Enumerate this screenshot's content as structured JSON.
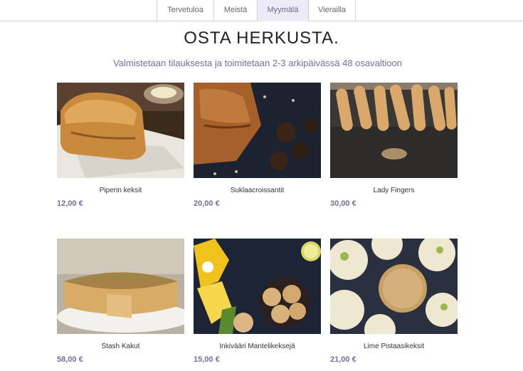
{
  "nav": {
    "tabs": [
      {
        "label": "Tervetuloa"
      },
      {
        "label": "Meistä"
      },
      {
        "label": "Myymälä"
      },
      {
        "label": "Vierailla"
      }
    ]
  },
  "page": {
    "title": "OSTA HERKUSTA.",
    "subtitle": "Valmistetaan tilauksesta ja toimitetaan 2-3 arkipäivässä 48 osavaltioon"
  },
  "products": [
    {
      "name": "Piperin keksit",
      "price": "12,00 €"
    },
    {
      "name": "Suklaacroissantit",
      "price": "20,00 €"
    },
    {
      "name": "Lady Fingers",
      "price": "30,00 €"
    },
    {
      "name": "Stash Kakut",
      "price": "58,00 €"
    },
    {
      "name": "Inkivääri Mantelikeksejä",
      "price": "15,00 €"
    },
    {
      "name": "Lime Pistaasikeksit",
      "price": "21,00 €"
    }
  ]
}
